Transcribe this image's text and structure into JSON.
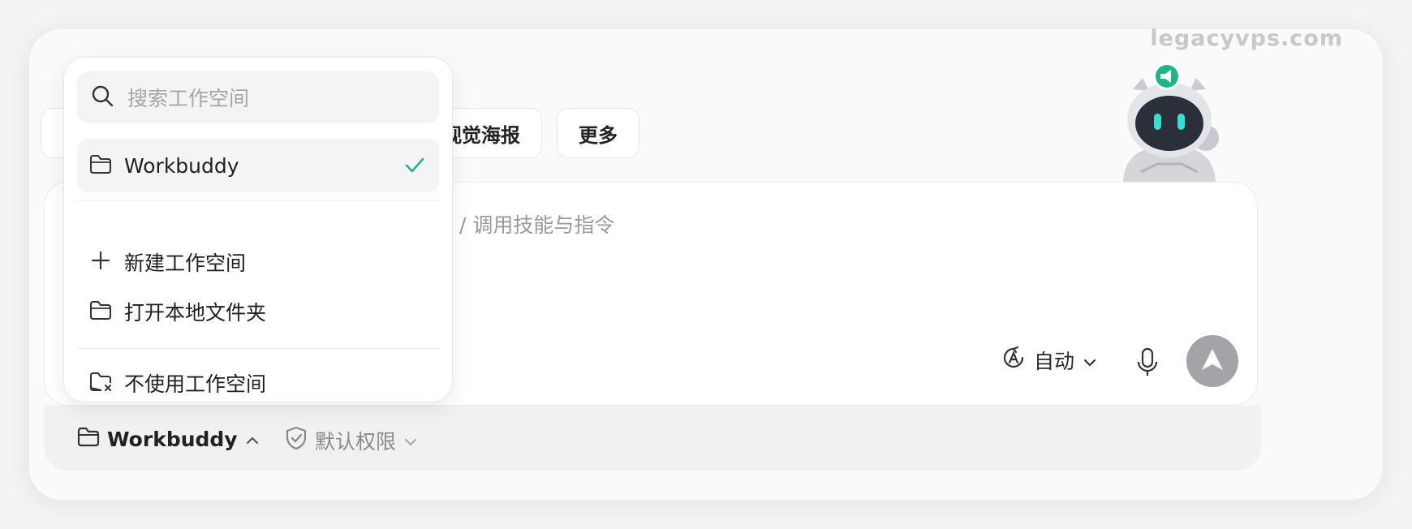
{
  "watermark": "legacyvps.com",
  "chips": {
    "poster": "视觉海报",
    "more": "更多"
  },
  "composer": {
    "placeholder": "/ 调用技能与指令",
    "mode_label": "自动"
  },
  "workspace_menu": {
    "search_placeholder": "搜索工作空间",
    "current_workspace": "Workbuddy",
    "new_workspace": "新建工作空间",
    "open_folder": "打开本地文件夹",
    "no_workspace": "不使用工作空间"
  },
  "footer": {
    "workspace_label": "Workbuddy",
    "permission_label": "默认权限"
  },
  "colors": {
    "accent_green": "#1fb58a",
    "send_button": "#a4a4a8"
  }
}
